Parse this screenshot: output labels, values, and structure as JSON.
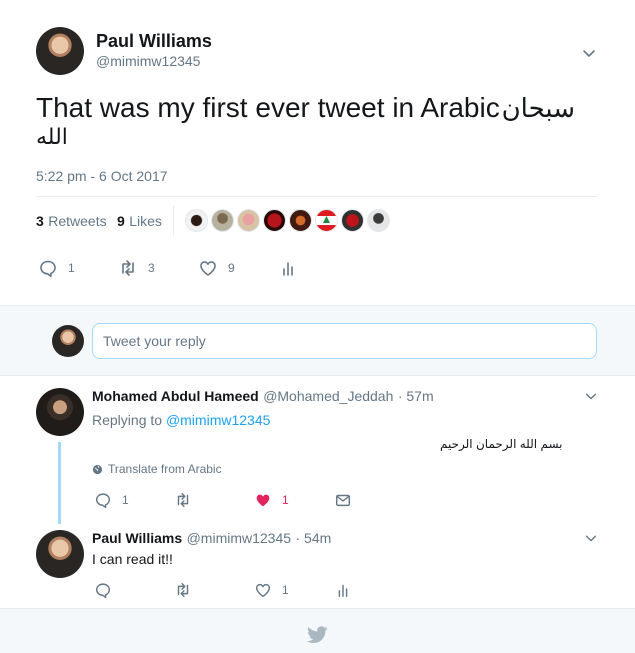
{
  "tweet": {
    "author_name": "Paul Williams",
    "author_handle": "@mimimw12345",
    "text_en": "That was my first ever tweet in Arabic",
    "text_ar_1": "سبحان",
    "text_ar_2": "الله",
    "timestamp": "5:22 pm - 6 Oct 2017",
    "retweets_count": "3",
    "retweets_label": "Retweets",
    "likes_count": "9",
    "likes_label": "Likes",
    "actions": {
      "reply_count": "1",
      "retweet_count": "3",
      "like_count": "9"
    }
  },
  "reply_box": {
    "placeholder": "Tweet your reply"
  },
  "replies": [
    {
      "author_name": "Mohamed Abdul Hameed",
      "author_handle": "@Mohamed_Jeddah",
      "time": "· 57m",
      "replying_to_label": "Replying to",
      "replying_to_handle": "@mimimw12345",
      "text_ar": "بسم الله الرحمان الرحيم",
      "translate_label": "Translate from Arabic",
      "reply_count": "1",
      "like_count": "1"
    },
    {
      "author_name": "Paul Williams",
      "author_handle": "@mimimw12345",
      "time": "· 54m",
      "text": "I can read it!!",
      "like_count": "1"
    }
  ],
  "colors": {
    "accent": "#1da1f2",
    "like_red": "#e0245e",
    "muted": "#657786",
    "border": "#e6ecf0"
  },
  "icons": [
    "chevron-down-icon",
    "reply-icon",
    "retweet-icon",
    "heart-icon",
    "analytics-icon",
    "dm-icon",
    "globe-icon",
    "twitter-bird-icon"
  ]
}
